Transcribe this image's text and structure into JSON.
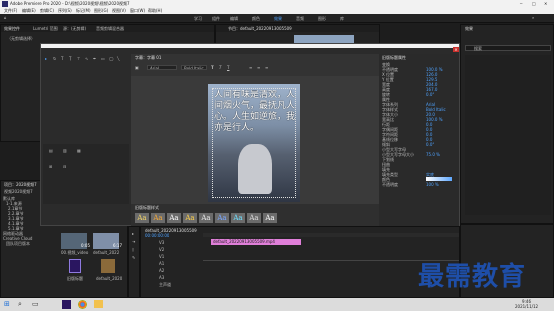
{
  "app": {
    "title": "Adobe Premiere Pro 2020 - D:\\视频\\2020视频\\视频\\2020视频7",
    "menu": [
      "文件(F)",
      "编辑(E)",
      "剪辑(C)",
      "序列(S)",
      "标记(M)",
      "图形(G)",
      "视图(V)",
      "窗口(W)",
      "帮助(H)"
    ],
    "workspaces": [
      "学习",
      "组件",
      "编辑",
      "颜色",
      "效果",
      "音频",
      "图形",
      "库"
    ],
    "active_workspace": "效果"
  },
  "source_panel": {
    "tabs": [
      "效果控件",
      "Lumetri 范围",
      "源：(无剪辑)",
      "音频剪辑混合器"
    ],
    "subtitle": "（无剪辑选择）"
  },
  "program_panel": {
    "tab": "节目：default_20220913005509"
  },
  "right_panel": {
    "tab": "效果",
    "subtab": "搜索"
  },
  "title_dialog": {
    "tab": "字幕：字幕 01",
    "font": "Arial",
    "style": "Bold Italic",
    "subtitle_text": "人间有味是清欢，人间烟火气，最抚凡人心。人生如逆旅，我亦是行人。",
    "styles_header": "旧版标题样式",
    "style_label": "Aa"
  },
  "properties": {
    "header": "旧版标题属性",
    "rows": [
      {
        "label": "变换",
        "value": ""
      },
      {
        "label": "不透明度",
        "value": "100.0 %"
      },
      {
        "label": "X 位置",
        "value": "126.0"
      },
      {
        "label": "Y 位置",
        "value": "129.5"
      },
      {
        "label": "宽度",
        "value": "204.0"
      },
      {
        "label": "高度",
        "value": "167.0"
      },
      {
        "label": "旋转",
        "value": "0.0°"
      },
      {
        "label": "属性",
        "value": ""
      },
      {
        "label": "字体系列",
        "value": "Arial"
      },
      {
        "label": "字体样式",
        "value": "Bold Italic"
      },
      {
        "label": "字体大小",
        "value": "20.0"
      },
      {
        "label": "宽高比",
        "value": "100.0 %"
      },
      {
        "label": "行距",
        "value": "0.0"
      },
      {
        "label": "字偶间距",
        "value": "0.0"
      },
      {
        "label": "字符间距",
        "value": "0.0"
      },
      {
        "label": "基线位移",
        "value": "0.0"
      },
      {
        "label": "倾斜",
        "value": "0.0°"
      },
      {
        "label": "小型大写字母",
        "value": ""
      },
      {
        "label": "小型大写字母大小",
        "value": "75.0 %"
      },
      {
        "label": "下划线",
        "value": ""
      },
      {
        "label": "扭曲",
        "value": ""
      },
      {
        "label": "填充",
        "value": ""
      },
      {
        "label": "填充类型",
        "value": "实底"
      },
      {
        "label": "颜色",
        "value": ""
      },
      {
        "label": "不透明度",
        "value": "100 %"
      }
    ]
  },
  "project": {
    "tab": "项目：2020视频7",
    "name": "视频2020视频7",
    "search_placeholder": "搜索",
    "tree": [
      "默认库",
      "1-1.来源",
      "2.1章节",
      "2.2.章节",
      "3.1.章节",
      "4.1.章节",
      "5.1.章节",
      "网络驱动器",
      "Creative Cloud",
      "团队项目版本"
    ],
    "thumbs": [
      {
        "label": "00.视频_video",
        "duration": "0:05"
      },
      {
        "label": "default_2022",
        "duration": "6:17"
      },
      {
        "label": "媒体剪辑",
        "duration": ""
      },
      {
        "label": "default_2020",
        "duration": ""
      }
    ],
    "thumb_labels2": [
      "旧版标题",
      "default_2020"
    ]
  },
  "timeline": {
    "tab": "default_20220913005509",
    "tracks": [
      "V3",
      "V2",
      "V1",
      "A1",
      "A2",
      "A3",
      "主声道"
    ],
    "clip": "default_20220913005509.mp4",
    "timecode": "00:00:00:00"
  },
  "taskbar": {
    "time": "9:46",
    "date": "2021/11/12"
  },
  "watermark": "最需教育",
  "colors": {
    "accent": "#2d8ceb",
    "clip": "#e07fd9",
    "watermark": "#1e4ea8"
  }
}
